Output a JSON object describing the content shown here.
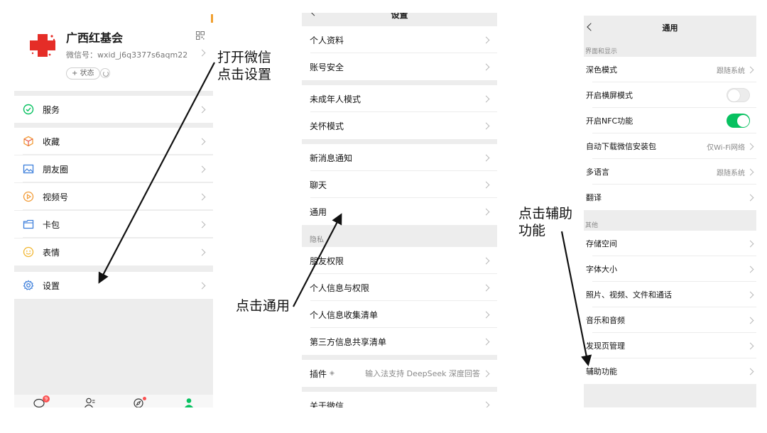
{
  "colors": {
    "accent_green": "#07c160",
    "red_cross": "#e52d27",
    "badge_red": "#fa5151"
  },
  "panel1": {
    "profile": {
      "name": "广西红基会",
      "wechat_id": "微信号：wxid_j6q3377s6aqm22",
      "status_button": "+ 状态"
    },
    "items": [
      {
        "label": "服务",
        "icon": "service-icon"
      },
      {
        "label": "收藏",
        "icon": "favorites-icon"
      },
      {
        "label": "朋友圈",
        "icon": "moments-icon"
      },
      {
        "label": "视频号",
        "icon": "channels-icon"
      },
      {
        "label": "卡包",
        "icon": "card-icon"
      },
      {
        "label": "表情",
        "icon": "sticker-icon"
      },
      {
        "label": "设置",
        "icon": "gear-icon"
      }
    ],
    "tabbar": {
      "chat_badge": "9"
    }
  },
  "panel2": {
    "title": "设置",
    "items": [
      {
        "label": "个人资料"
      },
      {
        "label": "账号安全"
      },
      {
        "label": "未成年人模式"
      },
      {
        "label": "关怀模式"
      },
      {
        "label": "新消息通知"
      },
      {
        "label": "聊天"
      },
      {
        "label": "通用"
      },
      {
        "label": "朋友权限"
      },
      {
        "label": "个人信息与权限"
      },
      {
        "label": "个人信息收集清单"
      },
      {
        "label": "第三方信息共享清单"
      },
      {
        "label": "插件",
        "value": "输入法支持 DeepSeek 深度回答"
      },
      {
        "label": "关于微信"
      }
    ],
    "privacy_header": "隐私"
  },
  "panel3": {
    "title": "通用",
    "section1": "界面和显示",
    "section2": "其他",
    "items": [
      {
        "label": "深色模式",
        "value": "跟随系统"
      },
      {
        "label": "开启横屏模式",
        "toggle": false
      },
      {
        "label": "开启NFC功能",
        "toggle": true
      },
      {
        "label": "自动下载微信安装包",
        "value": "仅Wi-Fi网络"
      },
      {
        "label": "多语言",
        "value": "跟随系统"
      },
      {
        "label": "翻译"
      },
      {
        "label": "存储空间"
      },
      {
        "label": "字体大小"
      },
      {
        "label": "照片、视频、文件和通话"
      },
      {
        "label": "音乐和音频"
      },
      {
        "label": "发现页管理"
      },
      {
        "label": "辅助功能"
      }
    ]
  },
  "annotations": {
    "step1": "打开微信\n点击设置",
    "step2": "点击通用",
    "step3": "点击辅助\n功能"
  }
}
